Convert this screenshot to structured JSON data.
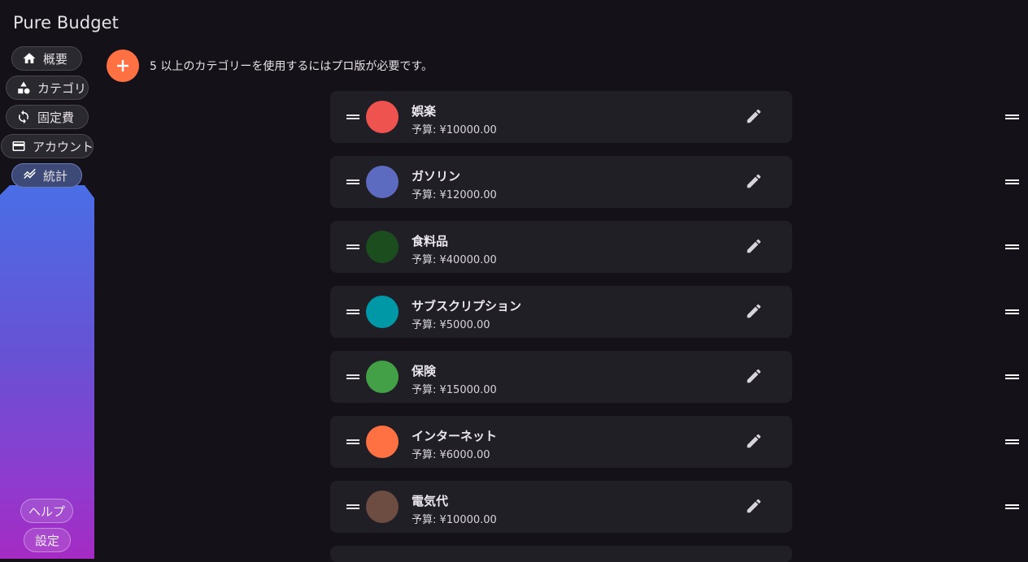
{
  "app": {
    "title": "Pure Budget"
  },
  "nav": {
    "items": [
      {
        "label": "概要",
        "icon": "home-icon"
      },
      {
        "label": "カテゴリ",
        "icon": "shapes-icon"
      },
      {
        "label": "固定費",
        "icon": "refresh-icon"
      },
      {
        "label": "アカウント",
        "icon": "wallet-icon"
      },
      {
        "label": "統計",
        "icon": "stats-icon",
        "active": true
      }
    ],
    "bottom": [
      {
        "label": "ヘルプ"
      },
      {
        "label": "設定"
      }
    ]
  },
  "header": {
    "notice": "5 以上のカテゴリーを使用するにはプロ版が必要です。"
  },
  "categories": [
    {
      "name": "娯楽",
      "budget": "予算: ¥10000.00",
      "color": "#ef5350"
    },
    {
      "name": "ガソリン",
      "budget": "予算: ¥12000.00",
      "color": "#5c6bc0"
    },
    {
      "name": "食料品",
      "budget": "予算: ¥40000.00",
      "color": "#1b4d1e"
    },
    {
      "name": "サブスクリプション",
      "budget": "予算: ¥5000.00",
      "color": "#0097a7"
    },
    {
      "name": "保険",
      "budget": "予算: ¥15000.00",
      "color": "#43a047"
    },
    {
      "name": "インターネット",
      "budget": "予算: ¥6000.00",
      "color": "#ff7043"
    },
    {
      "name": "電気代",
      "budget": "予算: ¥10000.00",
      "color": "#6d4c41"
    }
  ],
  "colors": {
    "background": "#141218",
    "card": "#211f26",
    "fab": "#ff7043"
  }
}
